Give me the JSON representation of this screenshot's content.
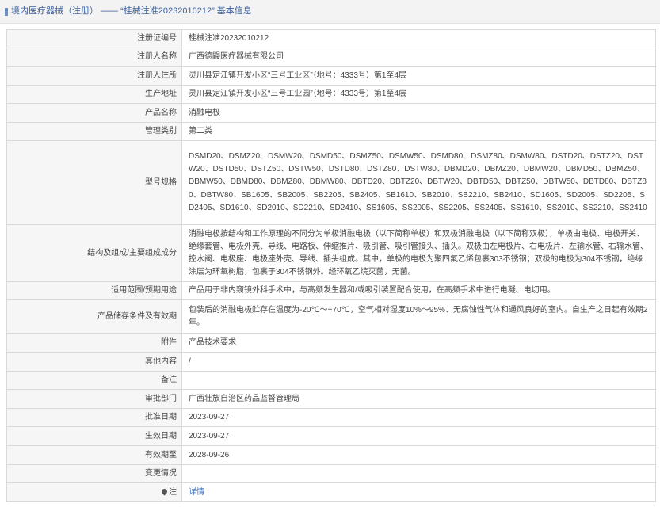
{
  "header": {
    "title": "境内医疗器械（注册） —— “桂械注准20232010212” 基本信息"
  },
  "fields": [
    {
      "key": "reg_no",
      "label": "注册证编号",
      "value": "桂械注准20232010212"
    },
    {
      "key": "registrant",
      "label": "注册人名称",
      "value": "广西德鼹医疗器械有限公司"
    },
    {
      "key": "residence",
      "label": "注册人住所",
      "value": "灵川县定江镇开发小区“三号工业区”（地号：4333号）第1至4层"
    },
    {
      "key": "prod_addr",
      "label": "生产地址",
      "value": "灵川县定江镇开发小区“三号工业园”（地号：4333号）第1至4层"
    },
    {
      "key": "product",
      "label": "产品名称",
      "value": "消融电极"
    },
    {
      "key": "class",
      "label": "管理类别",
      "value": "第二类"
    },
    {
      "key": "models",
      "label": "型号规格",
      "value": "DSMD20、DSMZ20、DSMW20、DSMD50、DSMZ50、DSMW50、DSMD80、DSMZ80、DSMW80、DSTD20、DSTZ20、DSTW20、DSTD50、DSTZ50、DSTW50、DSTD80、DSTZ80、DSTW80、DBMD20、DBMZ20、DBMW20、DBMD50、DBMZ50、DBMW50、DBMD80、DBMZ80、DBMW80、DBTD20、DBTZ20、DBTW20、DBTD50、DBTZ50、DBTW50、DBTD80、DBTZ80、DBTW80、SB1605、SB2005、SB2205、SB2405、SB1610、SB2010、SB2210、SB2410、SD1605、SD2005、SD2205、SD2405、SD1610、SD2010、SD2210、SD2410、SS1605、SS2005、SS2205、SS2405、SS1610、SS2010、SS2210、SS2410"
    },
    {
      "key": "structure",
      "label": "结构及组成/主要组成成分",
      "value": "消融电极按结构和工作原理的不同分为单极消融电极（以下简称单极）和双极消融电极（以下简称双极），单极由电极、电极开关、绝缘套管、电极外壳、导线、电路板、伸缩推片、吸引管、吸引管接头、插头。双极由左电极片、右电极片、左输水管、右输水管、控水阀、电极座、电极座外壳、导线、插头组成。其中，单极的电极为聚四氟乙烯包裹303不锈钢；双极的电极为304不锈钢，绝缘涂层为环氧树脂，包裹于304不锈钢外。经环氧乙烷灭菌，无菌。"
    },
    {
      "key": "scope",
      "label": "适用范围/预期用途",
      "value": "产品用于非内窥镜外科手术中，与高频发生器和/或吸引装置配合使用，在高频手术中进行电凝、电切用。"
    },
    {
      "key": "storage",
      "label": "产品储存条件及有效期",
      "value": "包装后的消融电极贮存在温度为-20℃～+70℃，空气相对湿度10%～95%、无腐蚀性气体和通风良好的室内。自生产之日起有效期2年。"
    },
    {
      "key": "attach",
      "label": "附件",
      "value": "产品技术要求"
    },
    {
      "key": "other",
      "label": "其他内容",
      "value": "/"
    },
    {
      "key": "remark",
      "label": "备注",
      "value": ""
    },
    {
      "key": "dept",
      "label": "审批部门",
      "value": "广西壮族自治区药品监督管理局"
    },
    {
      "key": "approve_date",
      "label": "批准日期",
      "value": "2023-09-27"
    },
    {
      "key": "effective_date",
      "label": "生效日期",
      "value": "2023-09-27"
    },
    {
      "key": "expiry_date",
      "label": "有效期至",
      "value": "2028-09-26"
    },
    {
      "key": "changes",
      "label": "变更情况",
      "value": ""
    },
    {
      "key": "note",
      "label": "注",
      "value": "详情"
    }
  ],
  "icons": {
    "header_marker": "title-marker-icon",
    "note_icon": "pin-icon"
  }
}
